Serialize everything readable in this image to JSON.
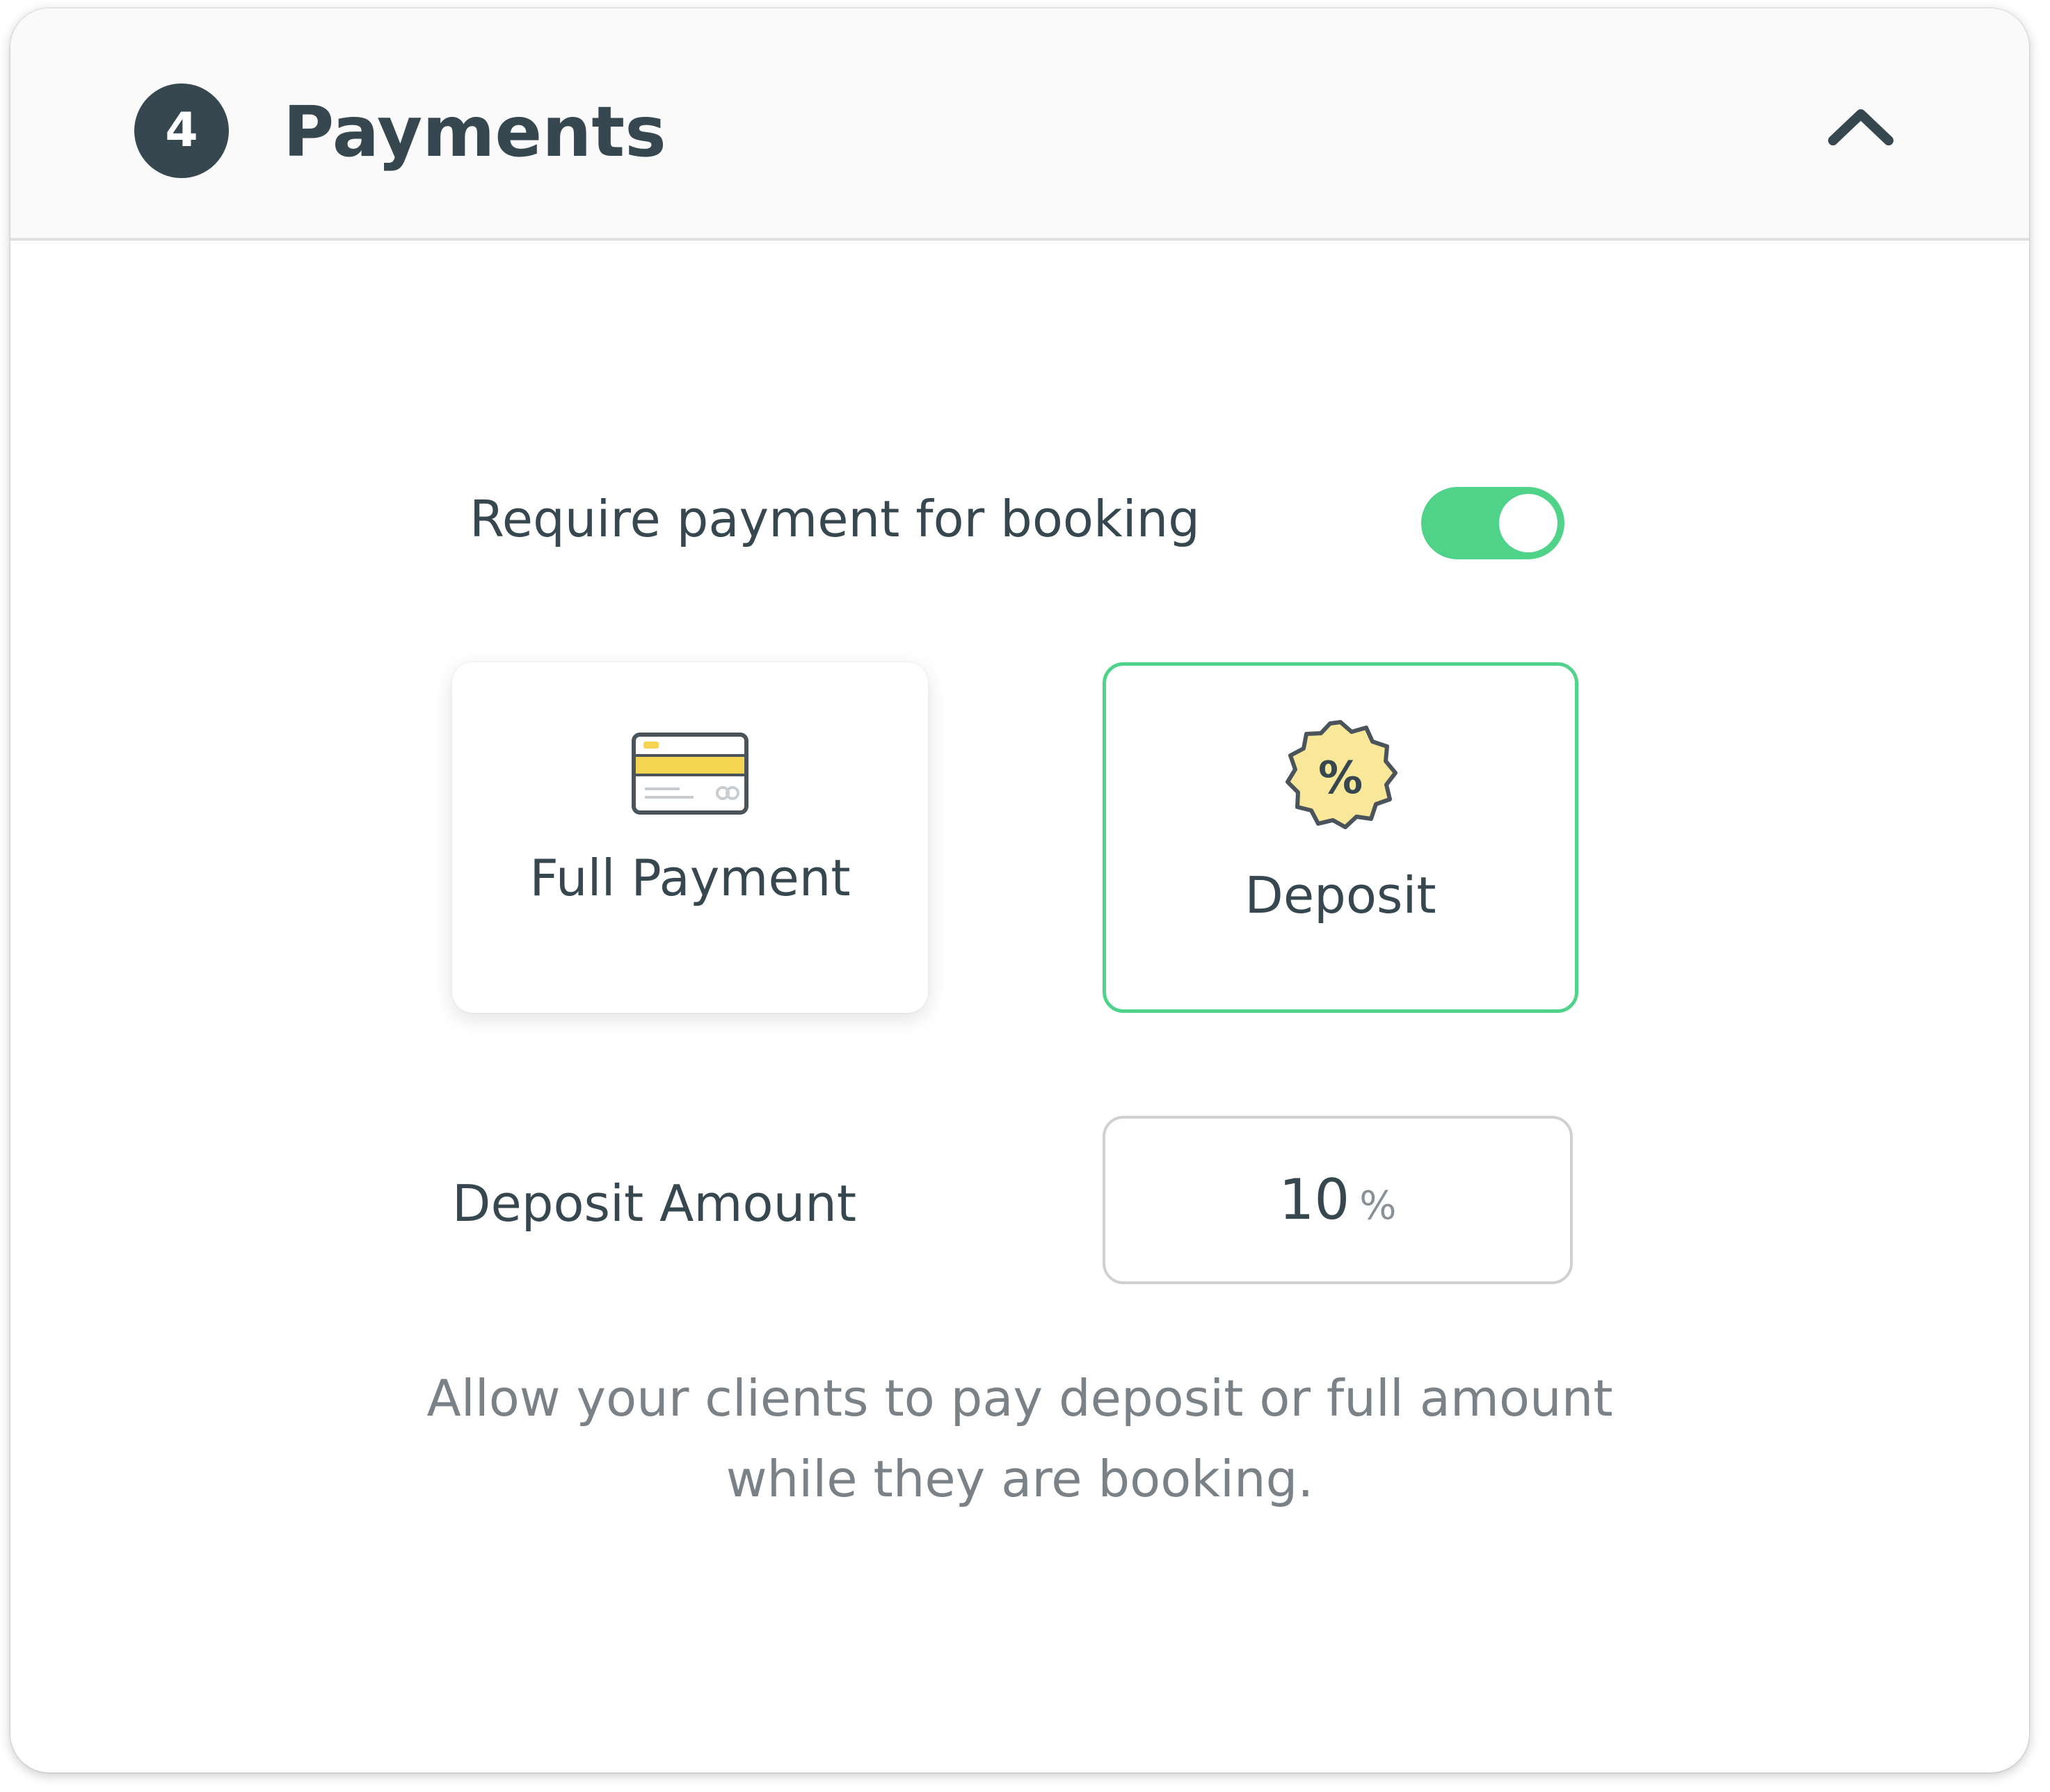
{
  "section": {
    "step_number": "4",
    "title": "Payments",
    "collapse_icon": "chevron-up-icon"
  },
  "require_payment": {
    "label": "Require payment for booking",
    "enabled": true
  },
  "payment_options": [
    {
      "label": "Full Payment",
      "icon": "credit-card-icon",
      "selected": false
    },
    {
      "label": "Deposit",
      "icon": "percent-badge-icon",
      "selected": true
    }
  ],
  "deposit_amount": {
    "label": "Deposit Amount",
    "value": "10",
    "unit": "%"
  },
  "help_text": "Allow your clients to pay deposit or full amount while they are booking.",
  "colors": {
    "accent": "#4fd389",
    "dark": "#37474f",
    "icon_yellow": "#f9e79a",
    "muted_text": "#7b8287"
  }
}
